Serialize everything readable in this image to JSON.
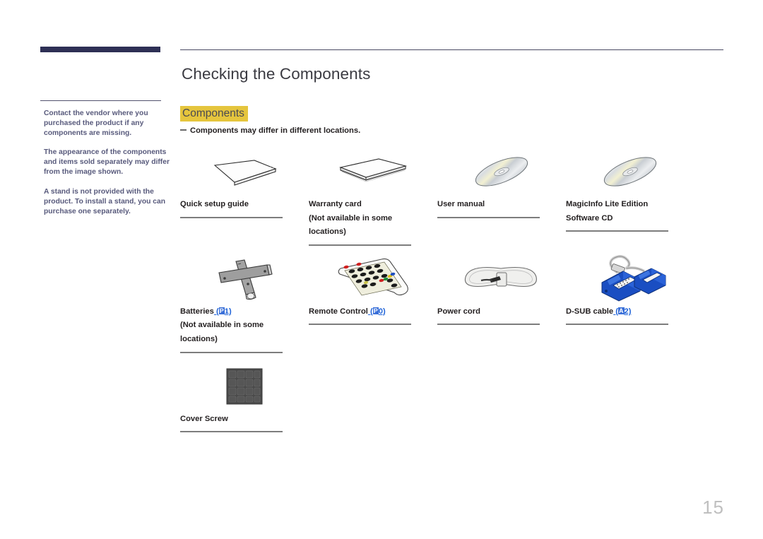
{
  "document": {
    "page_title": "Checking the Components",
    "page_number": "15",
    "section_heading": "Components",
    "section_note": "Components may differ in different locations.",
    "accent_highlight": "#e5c53d",
    "navy_bar_color": "#2e3055",
    "sidebar_text_color": "#585a7c",
    "link_color": "#1f63d8"
  },
  "sidebar": {
    "notes": [
      "Contact the vendor where you purchased the product if any components are missing.",
      "The appearance of the components and items sold separately may differ from the image shown.",
      "A stand is not provided with the product. To install a stand, you can purchase one separately."
    ]
  },
  "components": [
    {
      "icon": "quick-setup-guide-icon",
      "label": "Quick setup guide",
      "sub": "",
      "ref": "",
      "ref_glyph": ""
    },
    {
      "icon": "warranty-card-icon",
      "label": "Warranty card",
      "sub": "(Not available in some locations)",
      "ref": "",
      "ref_glyph": ""
    },
    {
      "icon": "user-manual-cd-icon",
      "label": "User manual",
      "sub": "",
      "ref": "",
      "ref_glyph": ""
    },
    {
      "icon": "magicinfo-cd-icon",
      "label": "MagicInfo Lite Edition Software CD",
      "sub": "",
      "ref": "",
      "ref_glyph": ""
    },
    {
      "icon": "batteries-icon",
      "label": "Batteries",
      "sub": "(Not available in some locations)",
      "ref": "1",
      "ref_glyph": "P"
    },
    {
      "icon": "remote-control-icon",
      "label": "Remote Control",
      "sub": "",
      "ref": "0",
      "ref_glyph": "P"
    },
    {
      "icon": "power-cord-icon",
      "label": "Power cord",
      "sub": "",
      "ref": "",
      "ref_glyph": ""
    },
    {
      "icon": "d-sub-cable-icon",
      "label": "D-SUB cable",
      "sub": "",
      "ref": "2",
      "ref_glyph": "A"
    },
    {
      "icon": "cover-screw-icon",
      "label": "Cover Screw",
      "sub": "",
      "ref": "",
      "ref_glyph": ""
    }
  ]
}
